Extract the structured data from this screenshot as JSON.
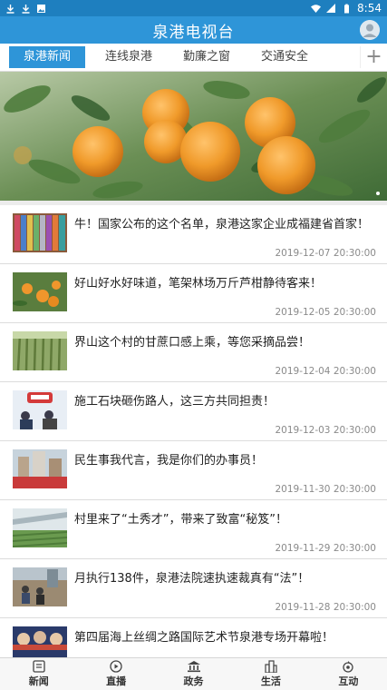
{
  "status_bar": {
    "icons_left": [
      "download-icon",
      "download-icon",
      "image-icon"
    ],
    "icons_right": [
      "wifi-icon",
      "signal-icon",
      "battery-icon"
    ],
    "time": "8:54"
  },
  "app_bar": {
    "title": "泉港电视台"
  },
  "tabs": [
    {
      "label": "泉港新闻",
      "active": true
    },
    {
      "label": "连线泉港",
      "active": false
    },
    {
      "label": "勤廉之窗",
      "active": false
    },
    {
      "label": "交通安全",
      "active": false
    }
  ],
  "news": [
    {
      "title": "牛！国家公布的这个名单，泉港这家企业成福建省首家！",
      "time": "2019-12-07 20:30:00"
    },
    {
      "title": "好山好水好味道，笔架林场万斤芦柑静待客来！",
      "time": "2019-12-05 20:30:00"
    },
    {
      "title": "界山这个村的甘蔗口感上乘，等您采摘品尝！",
      "time": "2019-12-04 20:30:00"
    },
    {
      "title": "施工石块砸伤路人，这三方共同担责！",
      "time": "2019-12-03 20:30:00"
    },
    {
      "title": "民生事我代言，我是你们的办事员！",
      "time": "2019-11-30 20:30:00"
    },
    {
      "title": "村里来了“土秀才”，带来了致富“秘笈”！",
      "time": "2019-11-29 20:30:00"
    },
    {
      "title": "月执行138件，泉港法院速执速裁真有“法”！",
      "time": "2019-11-28 20:30:00"
    },
    {
      "title": "第四届海上丝绸之路国际艺术节泉港专场开幕啦！",
      "time": ""
    }
  ],
  "bottom_nav": [
    {
      "label": "新闻",
      "icon": "news-icon"
    },
    {
      "label": "直播",
      "icon": "play-icon"
    },
    {
      "label": "政务",
      "icon": "government-icon"
    },
    {
      "label": "生活",
      "icon": "city-icon"
    },
    {
      "label": "互动",
      "icon": "interact-icon"
    }
  ],
  "colors": {
    "primary": "#2e95d8",
    "status_bar": "#1e7fbf"
  }
}
